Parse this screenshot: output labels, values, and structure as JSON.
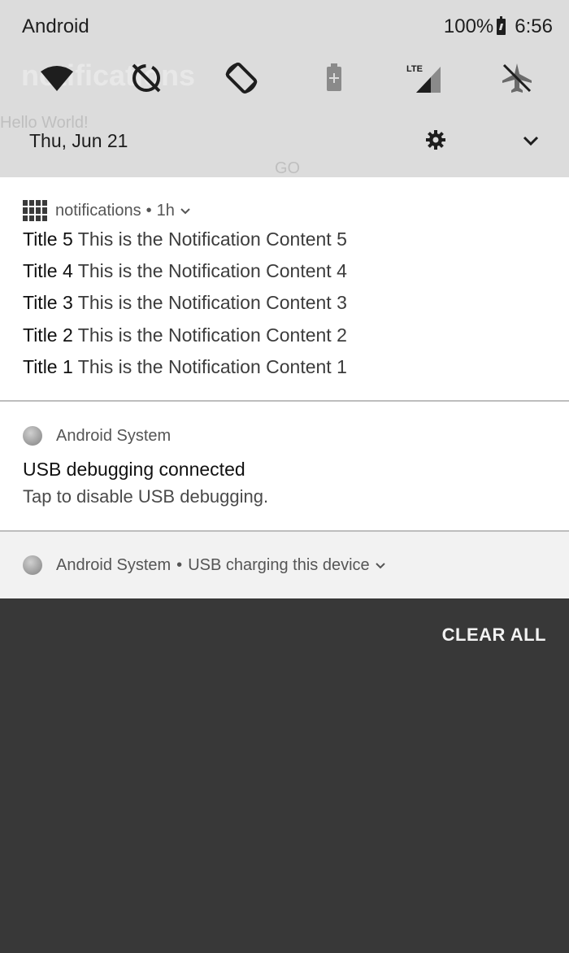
{
  "status_bar": {
    "carrier": "Android",
    "battery_percent": "100%",
    "time": "6:56"
  },
  "quick_settings": {
    "ghost_title": "notifications",
    "ghost_hello": "Hello World!",
    "ghost_go": "GO",
    "tiles": [
      {
        "icon": "wifi-icon"
      },
      {
        "icon": "data-saver-off-icon"
      },
      {
        "icon": "auto-rotate-icon"
      },
      {
        "icon": "battery-saver-icon"
      },
      {
        "icon": "lte-signal-icon"
      },
      {
        "icon": "airplane-mode-off-icon"
      }
    ]
  },
  "date_row": {
    "date": "Thu, Jun 21"
  },
  "notification_group": {
    "app_name": "notifications",
    "time": "1h",
    "separator": "•",
    "items": [
      {
        "title": "Title 5",
        "content": "This is the Notification Content 5"
      },
      {
        "title": "Title 4",
        "content": "This is the Notification Content 4"
      },
      {
        "title": "Title 3",
        "content": "This is the Notification Content 3"
      },
      {
        "title": "Title 2",
        "content": "This is the Notification Content 2"
      },
      {
        "title": "Title 1",
        "content": "This is the Notification Content 1"
      }
    ]
  },
  "usb_debugging": {
    "app_name": "Android System",
    "title": "USB debugging connected",
    "body": "Tap to disable USB debugging."
  },
  "usb_charging": {
    "app_name": "Android System",
    "separator": "•",
    "text": "USB charging this device"
  },
  "clear_all_label": "CLEAR ALL"
}
